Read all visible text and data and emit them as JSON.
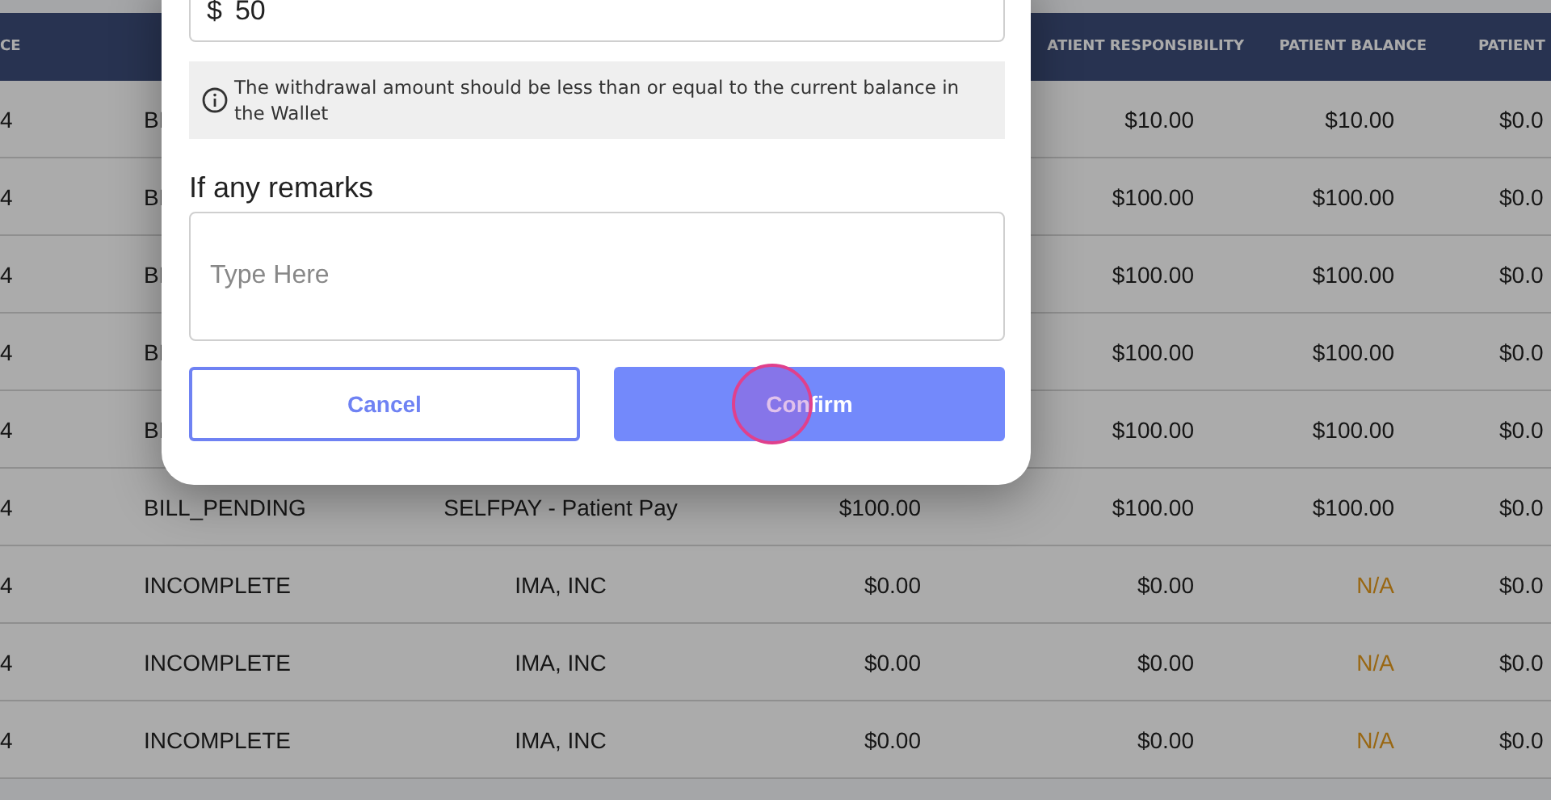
{
  "table": {
    "columns": [
      "CE",
      null,
      null,
      null,
      "ATIENT RESPONSIBILITY",
      "PATIENT BALANCE",
      "PATIENT"
    ],
    "rows": [
      {
        "cells": [
          "4",
          "BI",
          null,
          null,
          "$10.00",
          "$10.00",
          "$0.0"
        ]
      },
      {
        "cells": [
          "4",
          "BI",
          null,
          null,
          "$100.00",
          "$100.00",
          "$0.0"
        ]
      },
      {
        "cells": [
          "4",
          "BI",
          null,
          null,
          "$100.00",
          "$100.00",
          "$0.0"
        ]
      },
      {
        "cells": [
          "4",
          "BI",
          null,
          null,
          "$100.00",
          "$100.00",
          "$0.0"
        ]
      },
      {
        "cells": [
          "4",
          "BI",
          null,
          null,
          "$100.00",
          "$100.00",
          "$0.0"
        ]
      },
      {
        "cells": [
          "4",
          "BILL_PENDING",
          "SELFPAY - Patient Pay",
          "$100.00",
          "$100.00",
          "$100.00",
          "$0.0"
        ]
      },
      {
        "cells": [
          "4",
          "INCOMPLETE",
          "IMA, INC",
          "$0.00",
          "$0.00",
          {
            "text": "N/A",
            "kind": "na"
          },
          "$0.0"
        ]
      },
      {
        "cells": [
          "4",
          "INCOMPLETE",
          "IMA, INC",
          "$0.00",
          "$0.00",
          {
            "text": "N/A",
            "kind": "na"
          },
          "$0.0"
        ]
      },
      {
        "cells": [
          "4",
          "INCOMPLETE",
          "IMA, INC",
          "$0.00",
          "$0.00",
          {
            "text": "N/A",
            "kind": "na"
          },
          "$0.0"
        ]
      }
    ]
  },
  "dialog": {
    "amount": {
      "currency": "$",
      "value": "50"
    },
    "info": "The withdrawal amount should be less than or equal to the current balance in the Wallet",
    "remarks_label": "If any remarks",
    "remarks": {
      "placeholder": "Type Here"
    },
    "buttons": [
      {
        "label": "Cancel",
        "kind": "secondary"
      },
      {
        "label": "Confirm",
        "kind": "primary"
      }
    ]
  }
}
